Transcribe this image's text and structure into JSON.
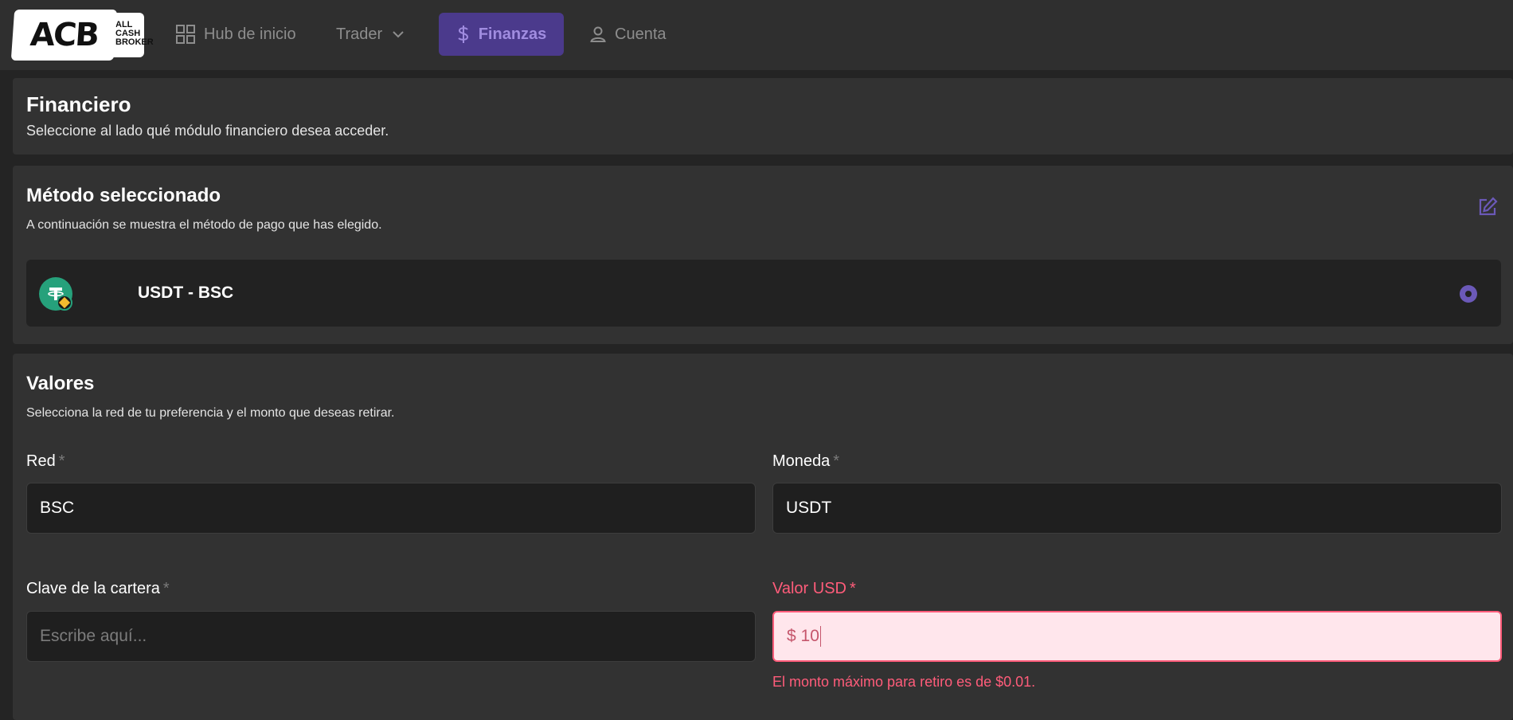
{
  "brand": {
    "logo_mark": "ACB",
    "logo_text_lines": [
      "ALL",
      "CASH",
      "BROKER"
    ]
  },
  "nav": {
    "items": [
      {
        "label": "Hub de inicio",
        "icon": "grid-icon"
      },
      {
        "label": "Trader",
        "icon": "chevron-down-icon"
      },
      {
        "label": "Finanzas",
        "icon": "dollar-icon",
        "active": true
      },
      {
        "label": "Cuenta",
        "icon": "user-icon"
      }
    ]
  },
  "financiero": {
    "title": "Financiero",
    "subtitle": "Seleccione al lado qué módulo financiero desea acceder."
  },
  "metodo": {
    "title": "Método seleccionado",
    "subtitle": "A continuación se muestra el método de pago que has elegido.",
    "selected": {
      "name": "USDT - BSC",
      "icon": "tether-icon",
      "badge_icon": "bnb-icon"
    }
  },
  "valores": {
    "title": "Valores",
    "subtitle": "Selecciona la red de tu preferencia y el monto que deseas retirar.",
    "fields": {
      "red": {
        "label": "Red",
        "required_mark": "*",
        "value": "BSC"
      },
      "moneda": {
        "label": "Moneda",
        "required_mark": "*",
        "value": "USDT"
      },
      "clave": {
        "label": "Clave de la cartera",
        "required_mark": "*",
        "value": "",
        "placeholder": "Escribe aquí..."
      },
      "valor": {
        "label": "Valor USD",
        "required_mark": "*",
        "value": "$ 10",
        "error": "El monto máximo para retiro es de $0.01."
      }
    }
  },
  "colors": {
    "accent": "#4b3a8c",
    "accent_text": "#a08ce0",
    "error": "#ff5c7a",
    "error_bg": "#ffe6ec",
    "tether": "#26a17b"
  }
}
